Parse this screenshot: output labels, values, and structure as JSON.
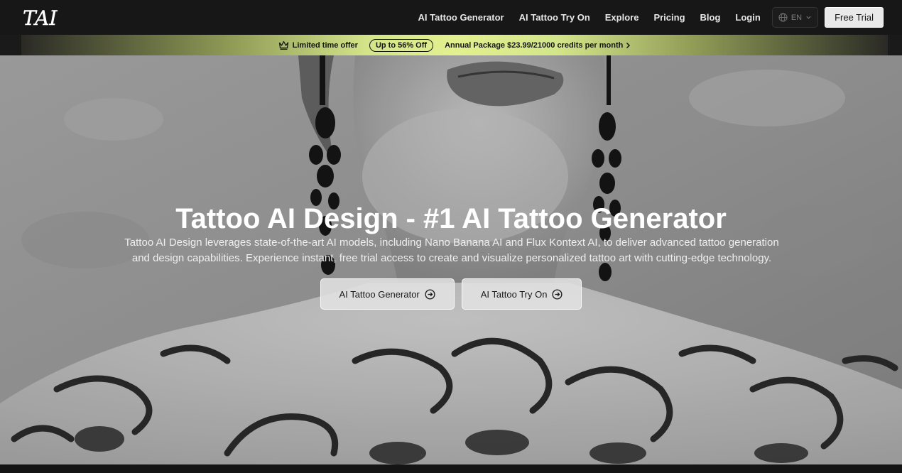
{
  "nav": {
    "logo_text": "TAI",
    "links": [
      "AI Tattoo Generator",
      "AI Tattoo Try On",
      "Explore",
      "Pricing",
      "Blog",
      "Login"
    ],
    "language": "EN",
    "free_trial": "Free Trial"
  },
  "promo": {
    "limited": "Limited time offer",
    "badge": "Up to 56% Off",
    "package": "Annual Package $23.99/21000 credits per month"
  },
  "hero": {
    "title": "Tattoo AI Design - #1 AI Tattoo Generator",
    "description": "Tattoo AI Design leverages state-of-the-art AI models, including Nano Banana AI and Flux Kontext AI, to deliver advanced tattoo generation and design capabilities. Experience instant, free trial access to create and visualize personalized tattoo art with cutting-edge technology.",
    "button_generator": "AI Tattoo Generator",
    "button_try_on": "AI Tattoo Try On"
  },
  "colors": {
    "nav_bg": "#171717",
    "promo_accent": "#e3f08f",
    "button_bg": "#e1e1e1"
  }
}
